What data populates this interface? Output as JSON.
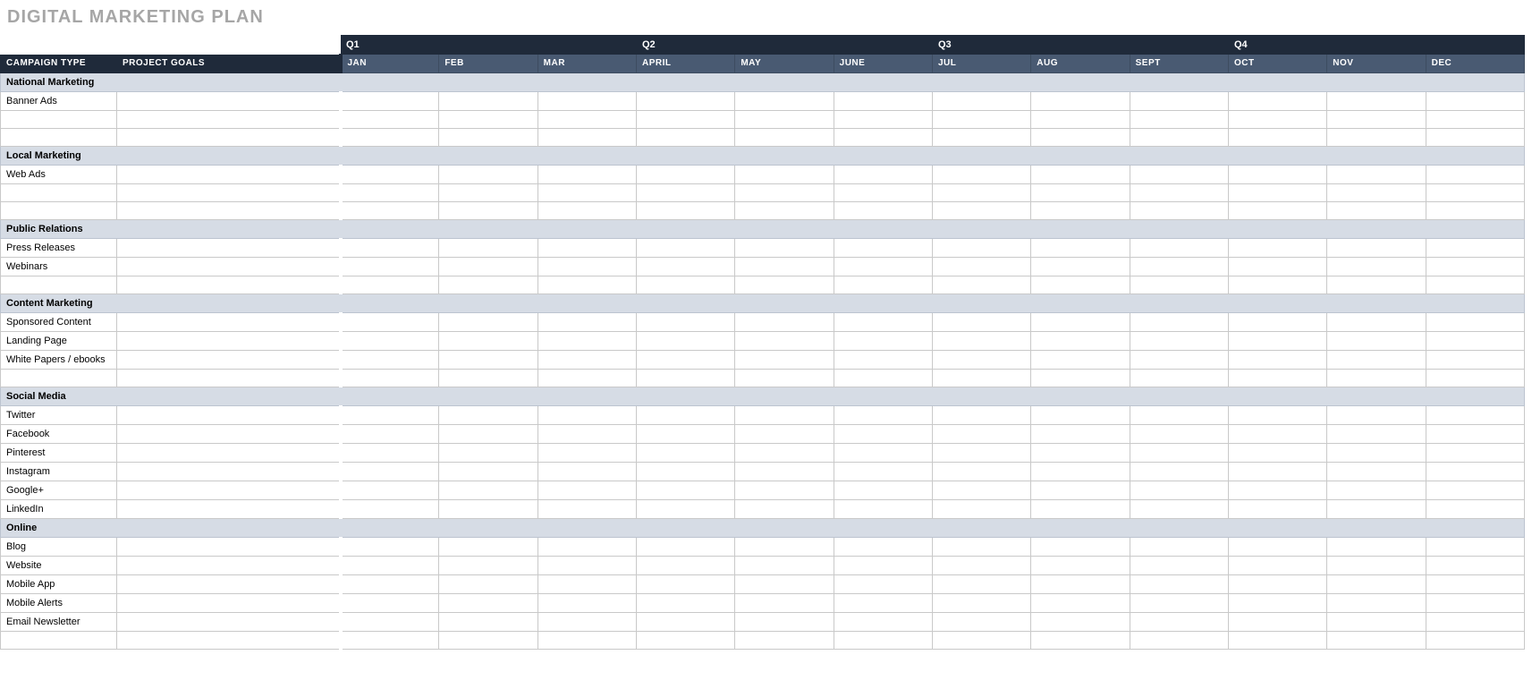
{
  "title": "DIGITAL MARKETING PLAN",
  "headers": {
    "campaign_type": "CAMPAIGN TYPE",
    "project_goals": "PROJECT GOALS"
  },
  "quarters": [
    "Q1",
    "Q2",
    "Q3",
    "Q4"
  ],
  "months": [
    "JAN",
    "FEB",
    "MAR",
    "APRIL",
    "MAY",
    "JUNE",
    "JUL",
    "AUG",
    "SEPT",
    "OCT",
    "NOV",
    "DEC"
  ],
  "sections": [
    {
      "name": "National Marketing",
      "rows": [
        "Banner Ads",
        "",
        ""
      ]
    },
    {
      "name": "Local Marketing",
      "rows": [
        "Web Ads",
        "",
        ""
      ]
    },
    {
      "name": "Public Relations",
      "rows": [
        "Press Releases",
        "Webinars",
        ""
      ]
    },
    {
      "name": "Content Marketing",
      "rows": [
        "Sponsored Content",
        "Landing Page",
        "White Papers / ebooks",
        ""
      ]
    },
    {
      "name": "Social Media",
      "rows": [
        "Twitter",
        "Facebook",
        "Pinterest",
        "Instagram",
        "Google+",
        "LinkedIn"
      ]
    },
    {
      "name": "Online",
      "rows": [
        "Blog",
        "Website",
        "Mobile App",
        "Mobile Alerts",
        "Email Newsletter",
        ""
      ]
    }
  ]
}
